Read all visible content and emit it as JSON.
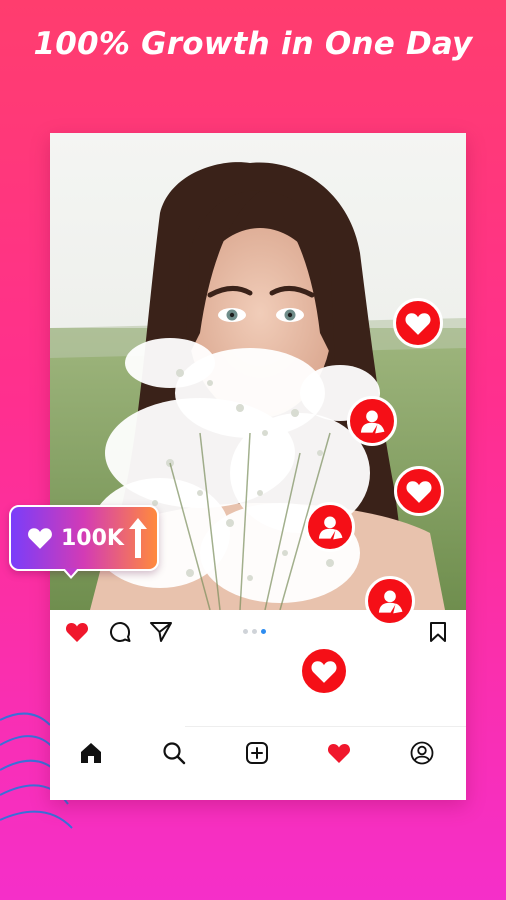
{
  "headline": "100% Growth in One Day",
  "colors": {
    "background_top": "#ff3d6e",
    "background_bottom": "#f52fc9",
    "like_red": "#f50f17",
    "card": "#ffffff",
    "active_dot": "#2d8cf0"
  },
  "post": {
    "photo_subject": "woman-holding-white-flowers-photo",
    "actions": [
      "heart-icon",
      "comment-icon",
      "share-icon",
      "bookmark-icon"
    ],
    "liked": true,
    "carousel": {
      "count": 3,
      "active_index": 2
    }
  },
  "bottom_nav": {
    "items": [
      "home-icon",
      "search-icon",
      "add-post-icon",
      "heart-icon",
      "profile-icon"
    ]
  },
  "badge": {
    "label": "100K",
    "icons": [
      "heart-icon",
      "up-arrow-icon"
    ]
  },
  "floating_bubbles": [
    "heart-bubble",
    "follower-bubble",
    "heart-bubble",
    "follower-bubble",
    "follower-bubble",
    "heart-bubble"
  ]
}
